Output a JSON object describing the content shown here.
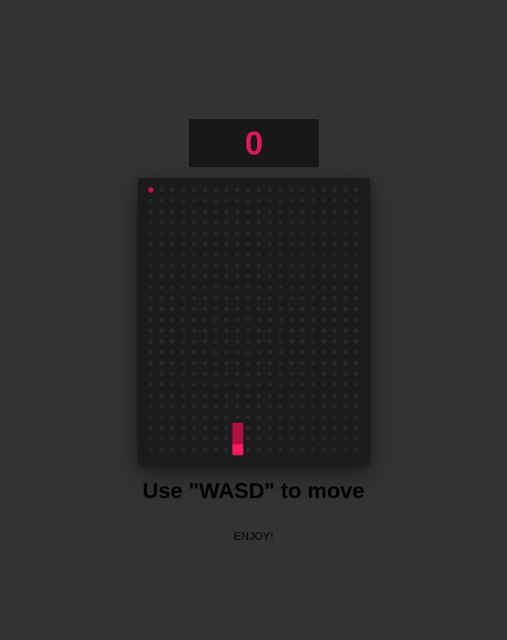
{
  "score": "0",
  "instructions": "Use \"WASD\" to move",
  "footer": "ENJOY!",
  "grid": {
    "columns": 20,
    "rows": 25
  },
  "snake": {
    "head": {
      "col": 8,
      "row": 24
    },
    "body": [
      {
        "col": 8,
        "row": 23
      },
      {
        "col": 8,
        "row": 22
      }
    ]
  },
  "food": {
    "col": 0,
    "row": 0
  },
  "colors": {
    "background": "#343235",
    "board": "#1b1a1d",
    "dot": "#28272a",
    "accent": "#e0185e",
    "snake_head": "#ff1a5e",
    "snake_body": "#b0103f",
    "food": "#c8104a"
  }
}
